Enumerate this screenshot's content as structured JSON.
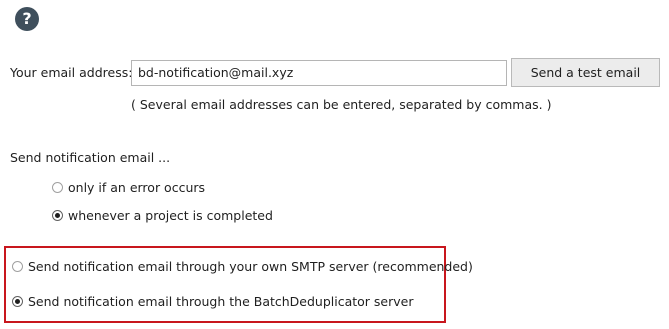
{
  "help": {
    "icon": "question-circle-icon",
    "glyph": "?"
  },
  "email": {
    "label": "Your email address:",
    "value": "bd-notification@mail.xyz",
    "hint": "( Several email addresses can be entered, separated by commas. )"
  },
  "test_button": {
    "label": "Send a test email"
  },
  "notify": {
    "heading": "Send notification email ...",
    "options": [
      {
        "label": "only if an error occurs",
        "checked": false
      },
      {
        "label": "whenever a project is completed",
        "checked": true
      }
    ]
  },
  "server": {
    "options": [
      {
        "label": "Send notification email through your own SMTP server (recommended)",
        "checked": false
      },
      {
        "label": "Send notification email through the BatchDeduplicator server",
        "checked": true
      }
    ]
  },
  "colors": {
    "highlight": "#c8161d",
    "help_icon": "#3f4f5c"
  }
}
